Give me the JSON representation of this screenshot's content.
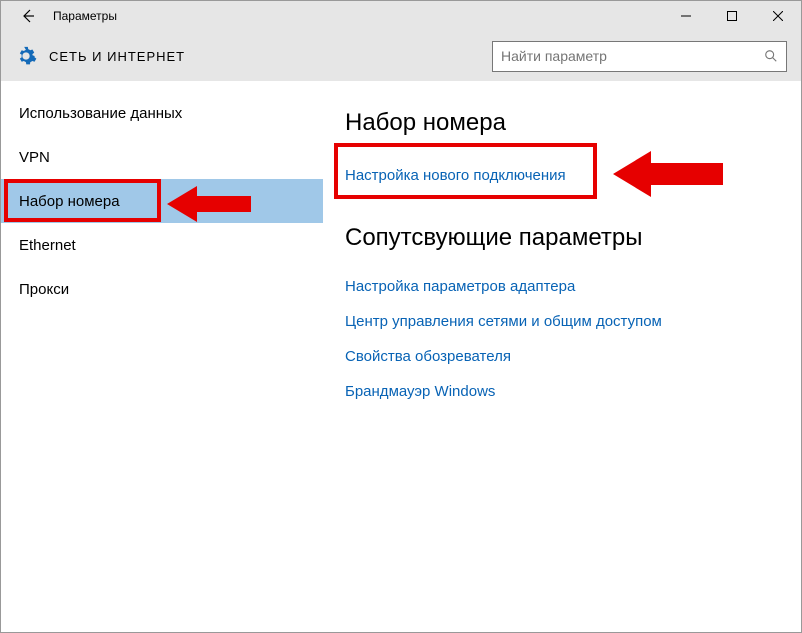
{
  "window": {
    "title": "Параметры"
  },
  "header": {
    "section": "СЕТЬ И ИНТЕРНЕТ"
  },
  "search": {
    "placeholder": "Найти параметр"
  },
  "sidebar": {
    "items": [
      {
        "label": "Использование данных"
      },
      {
        "label": "VPN"
      },
      {
        "label": "Набор номера"
      },
      {
        "label": "Ethernet"
      },
      {
        "label": "Прокси"
      }
    ]
  },
  "main": {
    "heading": "Набор номера",
    "primary_link": "Настройка нового подключения",
    "related_heading": "Сопутсвующие параметры",
    "related_links": [
      "Настройка параметров адаптера",
      "Центр управления сетями и общим доступом",
      "Свойства обозревателя",
      "Брандмауэр Windows"
    ]
  }
}
